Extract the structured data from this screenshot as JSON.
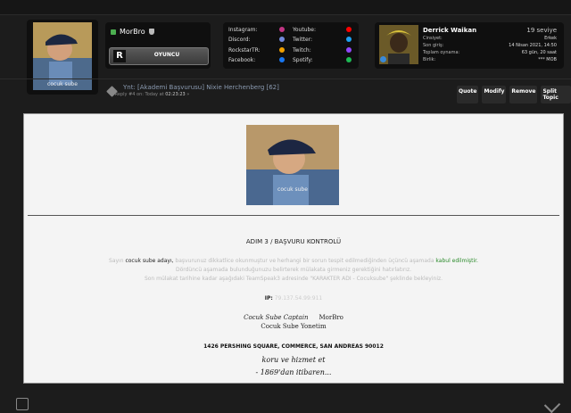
{
  "profile": {
    "avatar_caption": "cocuk sube",
    "username": "MorBro",
    "rank_logo": "R",
    "rank_label": "OYUNCU"
  },
  "social": {
    "left": [
      {
        "label": "Instagram:",
        "icon": "instagram-icon",
        "color": "#c13584"
      },
      {
        "label": "Discord:",
        "icon": "discord-icon",
        "color": "#7289da"
      },
      {
        "label": "RockstarTR:",
        "icon": "rockstar-icon",
        "color": "#f0a000"
      },
      {
        "label": "Facebook:",
        "icon": "facebook-icon",
        "color": "#1877f2"
      }
    ],
    "right": [
      {
        "label": "Youtube:",
        "icon": "youtube-icon",
        "color": "#ff0000"
      },
      {
        "label": "Twitter:",
        "icon": "twitter-icon",
        "color": "#1da1f2"
      },
      {
        "label": "Twitch:",
        "icon": "twitch-icon",
        "color": "#9146ff"
      },
      {
        "label": "Spotify:",
        "icon": "spotify-icon",
        "color": "#1db954"
      }
    ]
  },
  "member": {
    "name": "Derrick Waikan",
    "level": "19 seviye",
    "rows": [
      {
        "k": "Cinsiyet:",
        "v": "Erkek"
      },
      {
        "k": "Son giriş:",
        "v": "14 Nisan 2021, 14:50"
      },
      {
        "k": "Toplam oynama:",
        "v": "63 gün, 20 saat"
      },
      {
        "k": "Birlik:",
        "v": "*** MOB"
      }
    ]
  },
  "reply": {
    "title": "Ynt: [Akademi Başvurusu] Nixie Herchenberg [62]",
    "meta_prefix": "« Reply #4 on: Today at ",
    "meta_time": "02:23:23",
    "meta_suffix": " »"
  },
  "actions": [
    "Quote",
    "Modify",
    "Remove",
    "Split Topic"
  ],
  "post": {
    "image_caption": "cocuk sube",
    "step_title": "ADIM 3 / BAŞVURU KONTROLÜ",
    "line1_a": "Sayın ",
    "line1_b": "cocuk sube adayı,",
    "line1_c": " başvurunuz dikkatlice okunmuştur ve herhangi bir sorun tespit edilmediğinden üçüncü aşamada ",
    "line1_d": "kabul edilmiştir.",
    "line2": "Dördüncü aşamada bulunduğunuzu belirterek mülakata girmeniz gerektiğini hatırlatırız.",
    "line3": "Son mülakat tarihine kadar aşağıdaki TeamSpeak3 adresinde \"KARAKTER ADI - Cocuksube\" şeklinde bekleyiniz.",
    "ip_label": "IP:",
    "ip_value": "79.137.54.99:911",
    "sig_role": "Cocuk Sube Captain",
    "sig_name": "MorBro",
    "sig_org": "Cocuk Sube Yonetim",
    "address": "1426 PERSHING SQUARE, COMMERCE, SAN ANDREAS 90012",
    "script1": "koru ve hizmet et",
    "script2": "- 1869'dan itibaren..."
  }
}
